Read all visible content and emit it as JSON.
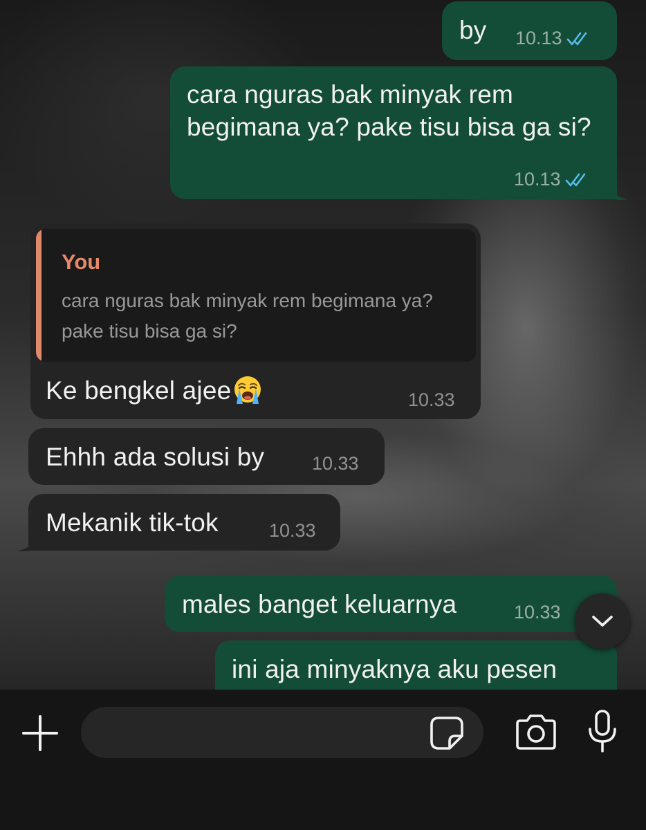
{
  "messages": [
    {
      "id": "m1",
      "text": "by",
      "time": "10.13"
    },
    {
      "id": "m2",
      "text": "cara nguras bak minyak rem begimana ya? pake tisu bisa ga si?",
      "time": "10.13"
    },
    {
      "id": "m3",
      "quote_name": "You",
      "quote_text": "cara nguras bak minyak rem begimana ya? pake tisu bisa ga si?",
      "text": "Ke bengkel ajee",
      "emoji": "loudly-crying-face",
      "time": "10.33"
    },
    {
      "id": "m4",
      "text": "Ehhh ada solusi by",
      "time": "10.33"
    },
    {
      "id": "m5",
      "text": "Mekanik tik-tok",
      "time": "10.33"
    },
    {
      "id": "m6",
      "text": "males banget keluarnya",
      "time": "10.33"
    },
    {
      "id": "m7",
      "text": "ini aja minyaknya aku pesen"
    }
  ],
  "composer": {
    "value": ""
  },
  "colors": {
    "outgoing_bubble": "#144d37",
    "incoming_bubble": "#242424",
    "read_ticks": "#53bdeb",
    "quote_accent": "#e08a6c"
  },
  "icons": [
    "double-check-icon",
    "loudly-crying-face-emoji",
    "chevron-down-icon",
    "plus-icon",
    "sticker-icon",
    "camera-icon",
    "microphone-icon"
  ]
}
